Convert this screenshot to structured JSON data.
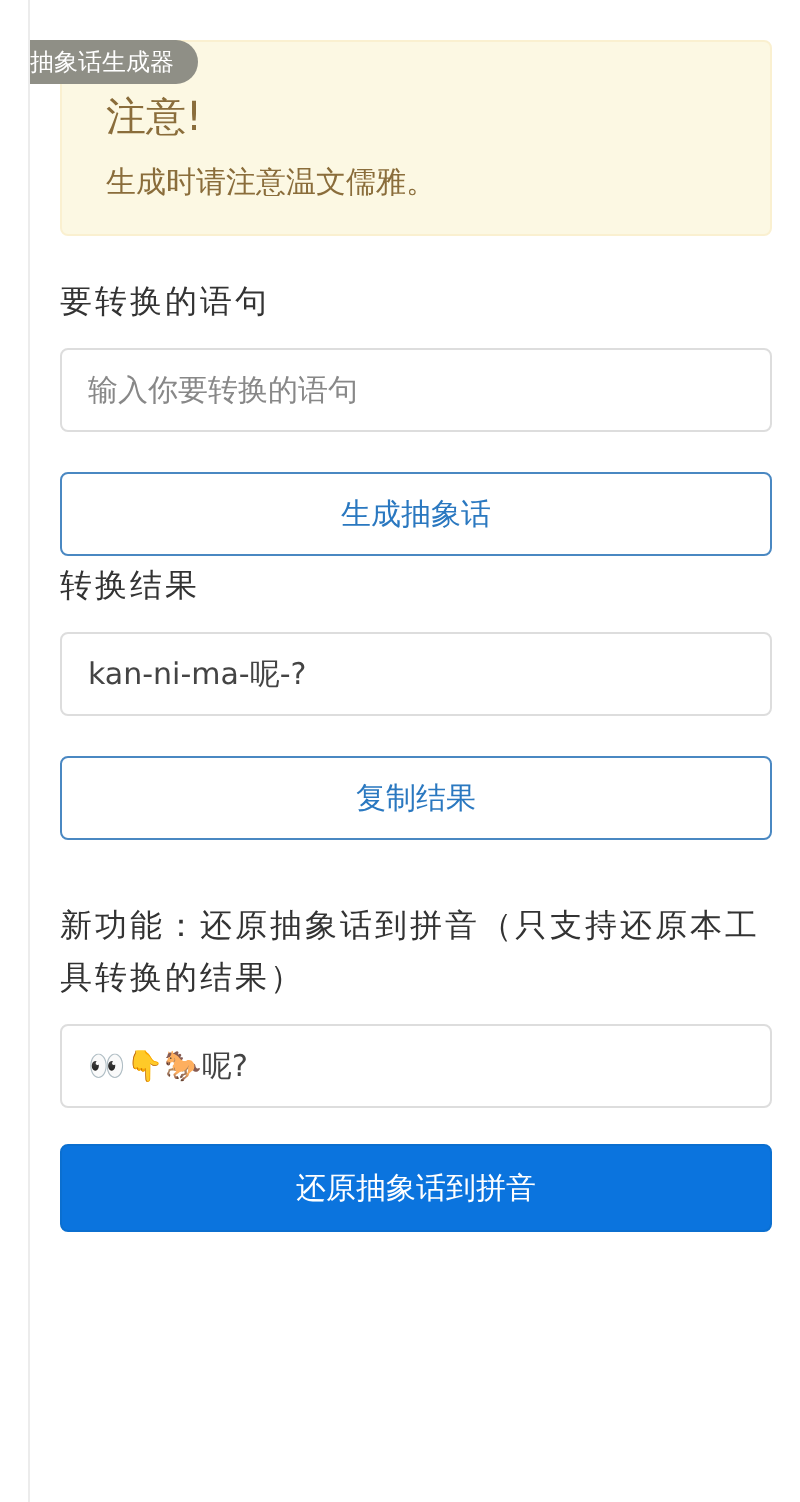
{
  "overlay_tag": {
    "label": "抽象话生成器"
  },
  "alert": {
    "title": "注意!",
    "message": "生成时请注意温文儒雅。"
  },
  "sections": [
    {
      "label": "要转换的语句",
      "field": {
        "placeholder": "输入你要转换的语句"
      },
      "button": {
        "label": "生成抽象话",
        "kind": "outline"
      }
    },
    {
      "label": "转换结果",
      "field": {
        "value": "kan-ni-ma-呢-?"
      },
      "button": {
        "label": "复制结果",
        "kind": "outline"
      }
    },
    {
      "label": "新功能：还原抽象话到拼音（只支持还原本工具转换的结果）",
      "field": {
        "value": "👀👇🐎呢?"
      },
      "button": {
        "label": "还原抽象话到拼音",
        "kind": "primary"
      }
    }
  ]
}
